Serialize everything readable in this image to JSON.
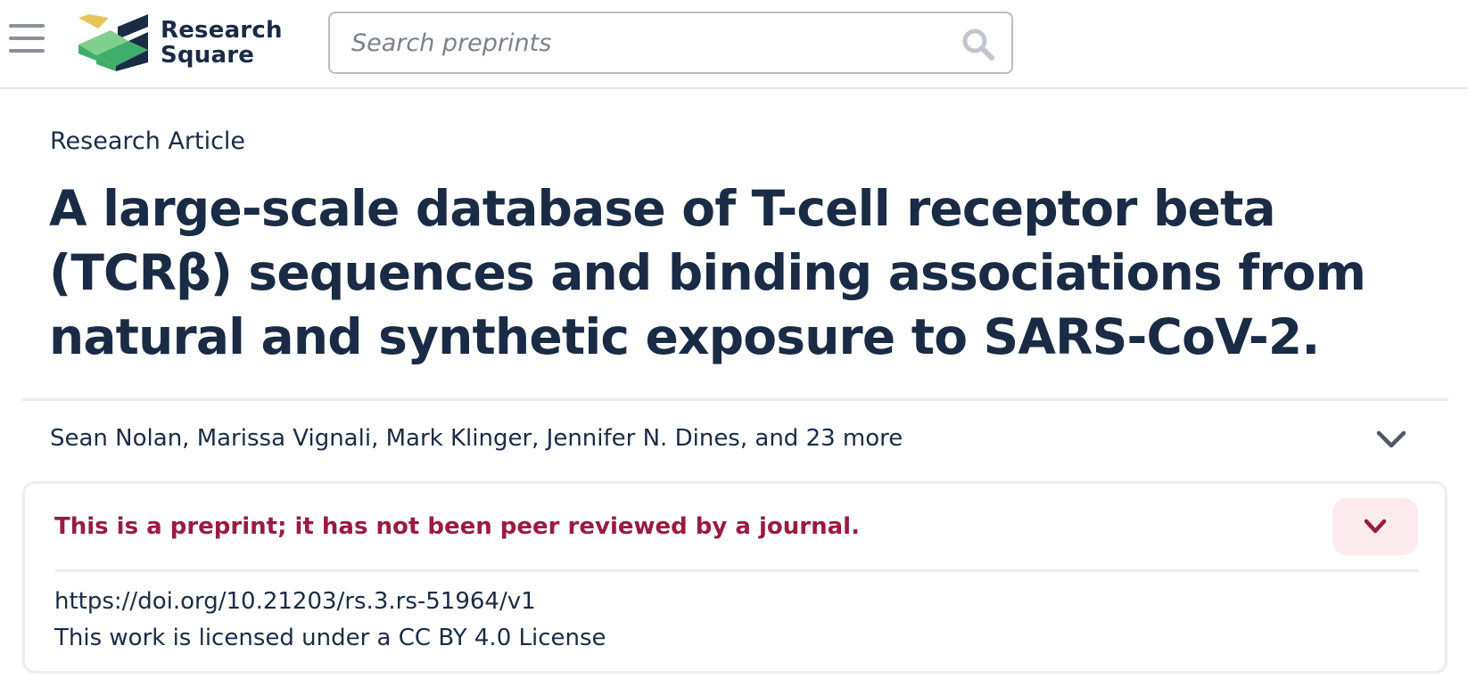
{
  "header": {
    "menu_icon": "hamburger-menu-icon",
    "logo": {
      "line1": "Research",
      "line2": "Square",
      "colors": {
        "yellow": "#e8c55a",
        "green": "#3fae6a",
        "light_green": "#7fd08c",
        "navy": "#1a2b45"
      }
    },
    "search": {
      "placeholder": "Search preprints",
      "value": "",
      "icon": "search-icon"
    }
  },
  "article": {
    "type": "Research Article",
    "title": "A large-scale database of T-cell receptor beta (TCRβ) sequences and binding associations from natural and synthetic exposure to SARS-CoV-2.",
    "authors": "Sean Nolan, Marissa Vignali, Mark Klinger, Jennifer N. Dines, and 23 more",
    "authors_toggle_icon": "chevron-down-icon"
  },
  "notice": {
    "text": "This is a preprint; it has not been peer reviewed by a journal.",
    "toggle_icon": "chevron-down-icon",
    "doi": "https://doi.org/10.21203/rs.3.rs-51964/v1",
    "license_prefix": "This work is licensed under a ",
    "license_link": "CC BY 4.0 License"
  },
  "colors": {
    "primary_text": "#1a2b45",
    "notice_text": "#9b1b3f",
    "notice_toggle_bg": "#fcebee",
    "border": "#eceef1"
  }
}
